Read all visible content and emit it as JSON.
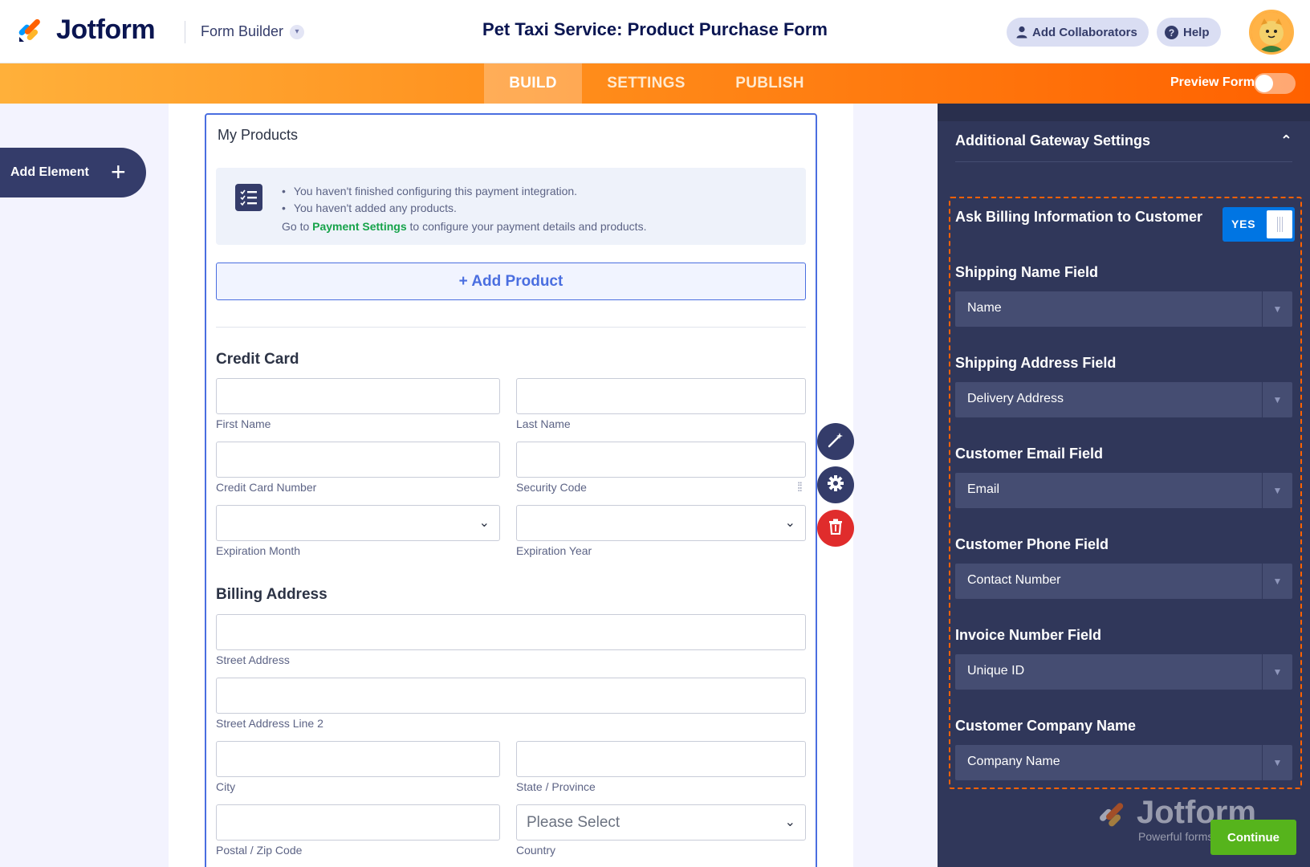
{
  "header": {
    "logo_text": "Jotform",
    "builder_label": "Form Builder",
    "form_title": "Pet Taxi Service: Product Purchase Form",
    "add_collaborators": "Add Collaborators",
    "help": "Help"
  },
  "nav": {
    "tabs": [
      {
        "label": "BUILD",
        "active": true
      },
      {
        "label": "SETTINGS",
        "active": false
      },
      {
        "label": "PUBLISH",
        "active": false
      }
    ],
    "preview_label": "Preview Form",
    "preview_enabled": false
  },
  "left": {
    "add_element": "Add Element"
  },
  "form": {
    "products_title": "My Products",
    "notice_items": [
      "You haven't finished configuring this payment integration.",
      "You haven't added any products."
    ],
    "notice_goto_prefix": "Go to",
    "notice_goto_link": "Payment Settings",
    "notice_goto_suffix": "to configure your payment details and products.",
    "add_product": "+ Add Product",
    "credit_card_heading": "Credit Card",
    "billing_heading": "Billing Address",
    "labels": {
      "first_name": "First Name",
      "last_name": "Last Name",
      "card_number": "Credit Card Number",
      "security_code": "Security Code",
      "exp_month": "Expiration Month",
      "exp_year": "Expiration Year",
      "street": "Street Address",
      "street2": "Street Address Line 2",
      "city": "City",
      "state": "State / Province",
      "postal": "Postal / Zip Code",
      "country": "Country"
    },
    "country_placeholder": "Please Select"
  },
  "panel": {
    "section_title": "Additional Gateway Settings",
    "billing_info_label": "Ask Billing Information to Customer",
    "billing_info_value": "YES",
    "fields": [
      {
        "label": "Shipping Name Field",
        "value": "Name"
      },
      {
        "label": "Shipping Address Field",
        "value": "Delivery Address"
      },
      {
        "label": "Customer Email Field",
        "value": "Email"
      },
      {
        "label": "Customer Phone Field",
        "value": "Contact Number"
      },
      {
        "label": "Invoice Number Field",
        "value": "Unique ID"
      },
      {
        "label": "Customer Company Name",
        "value": "Company Name"
      }
    ],
    "continue": "Continue",
    "watermark_brand": "Jotform",
    "watermark_tagline": "Powerful forms get"
  },
  "colors": {
    "brand_navy": "#0a1551",
    "orange": "#ff6100",
    "panel_bg": "#30375a",
    "accent_blue": "#4a6ee0",
    "yes_blue": "#0075e3",
    "continue_green": "#56b41c",
    "delete_red": "#e02c2c"
  }
}
